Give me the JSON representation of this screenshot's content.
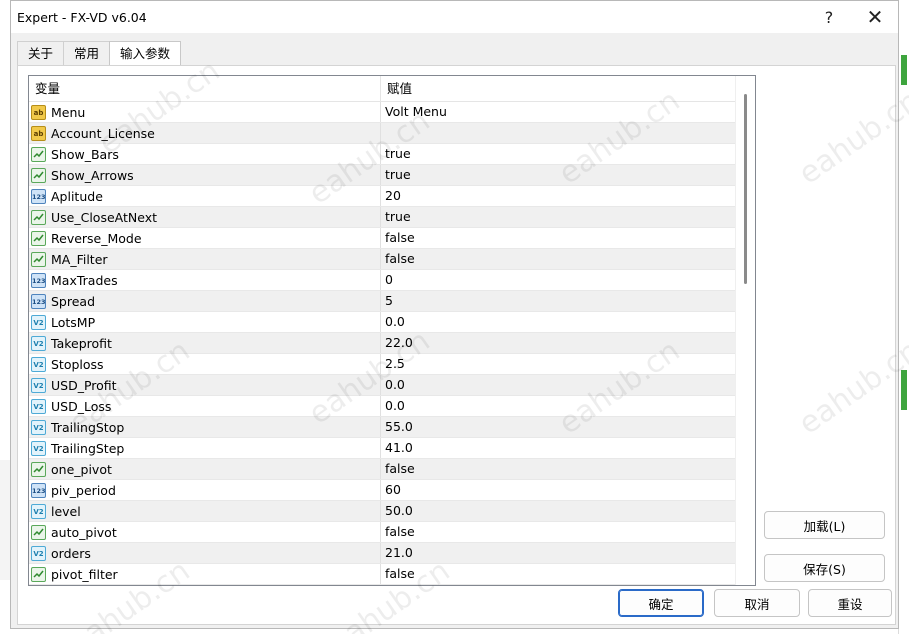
{
  "window": {
    "title": "Expert - FX-VD v6.04",
    "help_glyph": "?",
    "close_glyph": "✕"
  },
  "tabs": [
    {
      "label": "关于"
    },
    {
      "label": "常用"
    },
    {
      "label": "输入参数"
    }
  ],
  "grid": {
    "header_variable": "变量",
    "header_value": "赋值",
    "rows": [
      {
        "name": "Menu",
        "value": "Volt Menu",
        "type": "string"
      },
      {
        "name": "Account_License",
        "value": "",
        "type": "string"
      },
      {
        "name": "Show_Bars",
        "value": "true",
        "type": "bool"
      },
      {
        "name": "Show_Arrows",
        "value": "true",
        "type": "bool"
      },
      {
        "name": "Aplitude",
        "value": "20",
        "type": "int"
      },
      {
        "name": "Use_CloseAtNext",
        "value": "true",
        "type": "bool"
      },
      {
        "name": "Reverse_Mode",
        "value": "false",
        "type": "bool"
      },
      {
        "name": "MA_Filter",
        "value": "false",
        "type": "bool"
      },
      {
        "name": "MaxTrades",
        "value": "0",
        "type": "int"
      },
      {
        "name": "Spread",
        "value": "5",
        "type": "int"
      },
      {
        "name": "LotsMP",
        "value": "0.0",
        "type": "double"
      },
      {
        "name": "Takeprofit",
        "value": "22.0",
        "type": "double"
      },
      {
        "name": "Stoploss",
        "value": "2.5",
        "type": "double"
      },
      {
        "name": "USD_Profit",
        "value": "0.0",
        "type": "double"
      },
      {
        "name": "USD_Loss",
        "value": "0.0",
        "type": "double"
      },
      {
        "name": "TrailingStop",
        "value": "55.0",
        "type": "double"
      },
      {
        "name": "TrailingStep",
        "value": "41.0",
        "type": "double"
      },
      {
        "name": "one_pivot",
        "value": "false",
        "type": "bool"
      },
      {
        "name": "piv_period",
        "value": "60",
        "type": "int"
      },
      {
        "name": "level",
        "value": "50.0",
        "type": "double"
      },
      {
        "name": "auto_pivot",
        "value": "false",
        "type": "bool"
      },
      {
        "name": "orders",
        "value": "21.0",
        "type": "double"
      },
      {
        "name": "pivot_filter",
        "value": "false",
        "type": "bool"
      }
    ]
  },
  "icon_glyphs": {
    "string": "ab",
    "int": "123",
    "double": "V2"
  },
  "buttons": {
    "load": "加载(L)",
    "save": "保存(S)",
    "ok": "确定",
    "cancel": "取消",
    "reset": "重设"
  },
  "watermark": "eahub.cn",
  "colors": {
    "ok_border": "#2a6ac8",
    "bool_icon": "#5aa85a",
    "string_icon": "#f1c94a",
    "int_icon": "#4f84bd",
    "double_icon": "#4eaad6"
  }
}
